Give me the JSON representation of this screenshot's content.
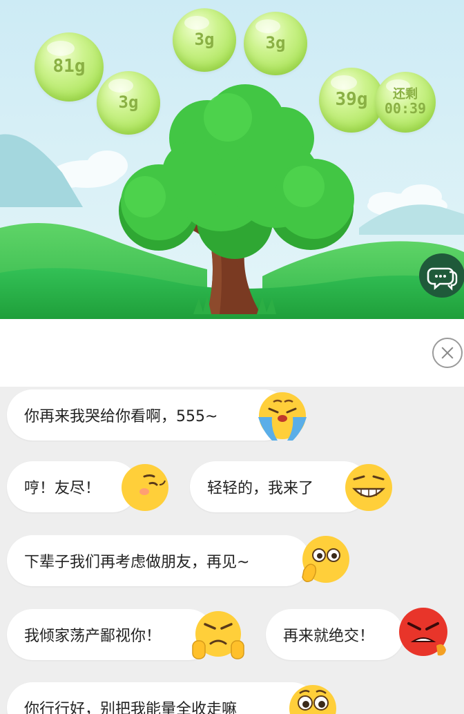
{
  "energy": {
    "bubbles": [
      {
        "label": "81g"
      },
      {
        "label": "3g"
      },
      {
        "label": "3g"
      },
      {
        "label": "3g"
      },
      {
        "label": "39g"
      }
    ],
    "countdown": {
      "label": "还剩",
      "time": "00:39"
    }
  },
  "icons": {
    "chat": "chat-bubbles-icon",
    "close": "close-icon"
  },
  "messages": [
    {
      "text": "你再来我哭给你看啊，555~",
      "emoji": "crying-face-icon"
    },
    {
      "text": "哼！友尽！",
      "emoji": "annoyed-face-icon"
    },
    {
      "text": "轻轻的，我来了",
      "emoji": "grinning-face-icon"
    },
    {
      "text": "下辈子我们再考虑做朋友，再见~",
      "emoji": "waving-face-icon"
    },
    {
      "text": "我倾家荡产鄙视你！",
      "emoji": "middle-finger-face-icon"
    },
    {
      "text": "再来就绝交！",
      "emoji": "angry-face-icon"
    },
    {
      "text": "你行行好，别把我能量全收走嘛",
      "emoji": "pleading-face-icon"
    }
  ],
  "colors": {
    "bubble": "#b2e764",
    "tree_leaves": "#3cc43c",
    "grass": "#2db646",
    "sky": "#d9f0f6"
  }
}
